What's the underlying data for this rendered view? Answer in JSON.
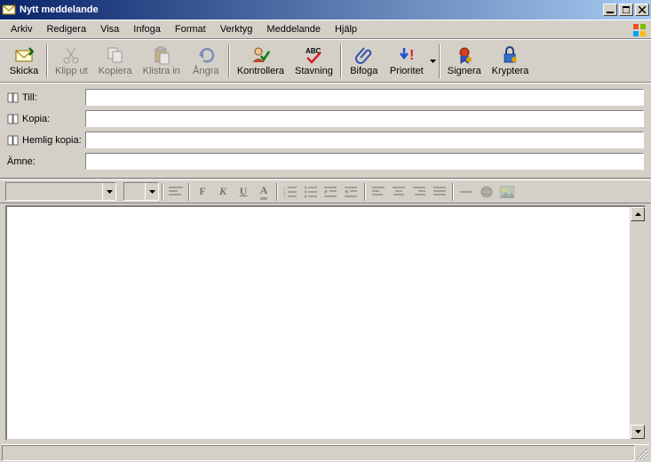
{
  "title": "Nytt meddelande",
  "menu": {
    "arkiv": "Arkiv",
    "redigera": "Redigera",
    "visa": "Visa",
    "infoga": "Infoga",
    "format": "Format",
    "verktyg": "Verktyg",
    "meddelande": "Meddelande",
    "hjalp": "Hjälp"
  },
  "toolbar": {
    "skicka": "Skicka",
    "klipp_ut": "Klipp ut",
    "kopiera": "Kopiera",
    "klistra_in": "Klistra in",
    "angra": "Ångra",
    "kontrollera": "Kontrollera",
    "stavning": "Stavning",
    "bifoga": "Bifoga",
    "prioritet": "Prioritet",
    "signera": "Signera",
    "kryptera": "Kryptera"
  },
  "headers": {
    "till": "Till:",
    "kopia": "Kopia:",
    "hemlig_kopia": "Hemlig kopia:",
    "amne": "Ämne:",
    "till_value": "",
    "kopia_value": "",
    "hemlig_value": "",
    "amne_value": ""
  },
  "format_toolbar": {
    "font_value": "",
    "size_value": ""
  },
  "format_buttons": {
    "bold": "F",
    "italic": "K",
    "underline": "U",
    "color": "A"
  },
  "body": ""
}
